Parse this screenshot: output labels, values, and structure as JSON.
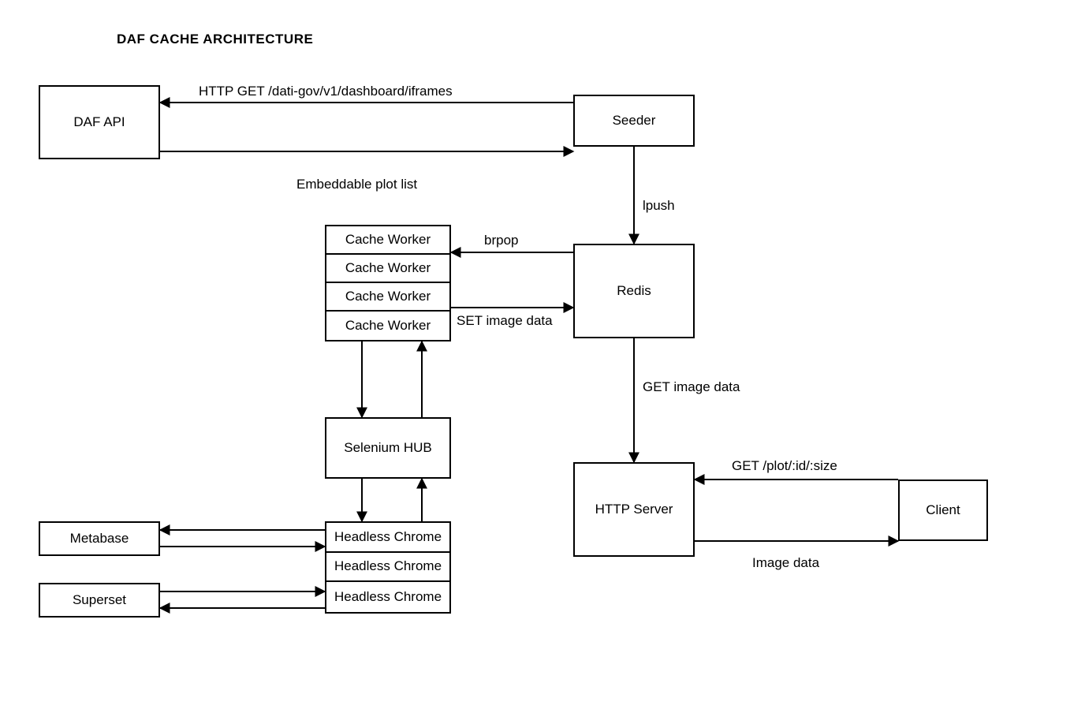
{
  "title": "DAF CACHE ARCHITECTURE",
  "nodes": {
    "daf_api": {
      "label": "DAF API"
    },
    "seeder": {
      "label": "Seeder"
    },
    "redis": {
      "label": "Redis"
    },
    "http_server": {
      "label": "HTTP Server"
    },
    "client": {
      "label": "Client"
    },
    "selenium": {
      "label": "Selenium HUB"
    },
    "metabase": {
      "label": "Metabase"
    },
    "superset": {
      "label": "Superset"
    },
    "cache_workers": [
      "Cache Worker",
      "Cache Worker",
      "Cache Worker",
      "Cache Worker"
    ],
    "headless_chrome": [
      "Headless Chrome",
      "Headless Chrome",
      "Headless Chrome"
    ]
  },
  "edges": {
    "http_get": "HTTP GET /dati-gov/v1/dashboard/iframes",
    "embeddable_list": "Embeddable plot list",
    "lpush": "lpush",
    "brpop": "brpop",
    "set_image": "SET image data",
    "get_image": "GET image data",
    "get_plot": "GET /plot/:id/:size",
    "image_data": "Image data"
  }
}
